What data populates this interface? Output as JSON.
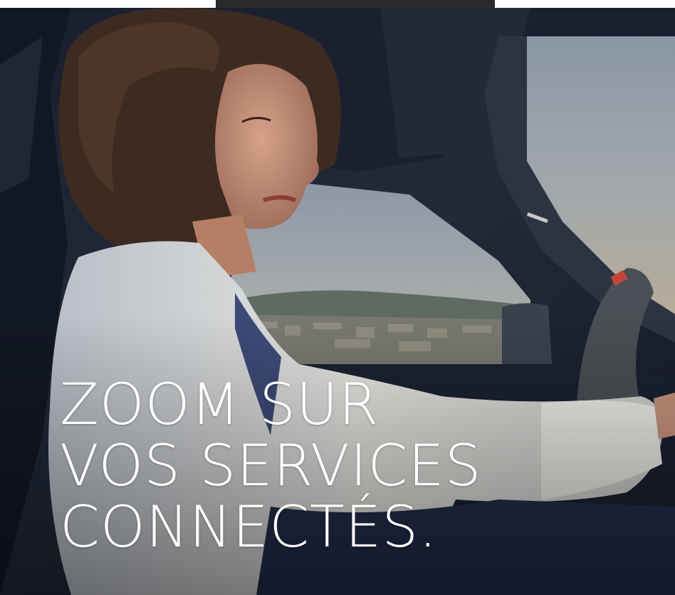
{
  "hero": {
    "headline_lines": [
      "ZOOM SUR",
      "VOS SERVICES",
      "CONNECTÉS."
    ],
    "image": "woman-driving-car-photo"
  },
  "colors": {
    "top_tab": "#2b2a2a",
    "headline_text": "#ffffff"
  }
}
